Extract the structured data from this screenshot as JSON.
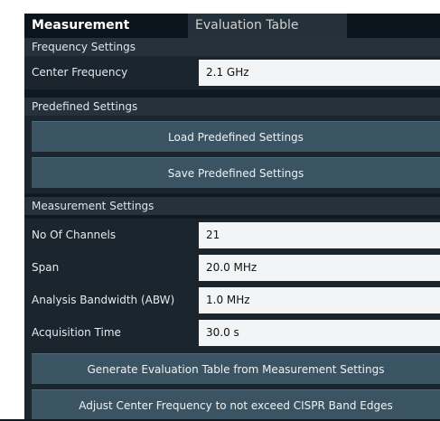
{
  "tabs": {
    "measurement_settings": "Measurement Settings",
    "evaluation_table": "Evaluation Table"
  },
  "frequency_section": {
    "title": "Frequency Settings",
    "center_frequency_label": "Center Frequency",
    "center_frequency_value": "2.1 GHz"
  },
  "predefined_section": {
    "title": "Predefined Settings",
    "load_button": "Load Predefined Settings",
    "save_button": "Save Predefined Settings"
  },
  "measurement_section": {
    "title": "Measurement Settings",
    "channels_label": "No Of Channels",
    "channels_value": "21",
    "span_label": "Span",
    "span_value": "20.0 MHz",
    "abw_label": "Analysis Bandwidth (ABW)",
    "abw_value": "1.0 MHz",
    "acq_label": "Acquisition Time",
    "acq_value": "30.0 s",
    "generate_button": "Generate Evaluation Table from Measurement Settings",
    "adjust_button": "Adjust Center Frequency to not exceed CISPR Band Edges"
  },
  "colors": {
    "background": "#1b252e",
    "section_header": "#25313b",
    "button": "#3b5463",
    "field": "#f2f4f5"
  }
}
